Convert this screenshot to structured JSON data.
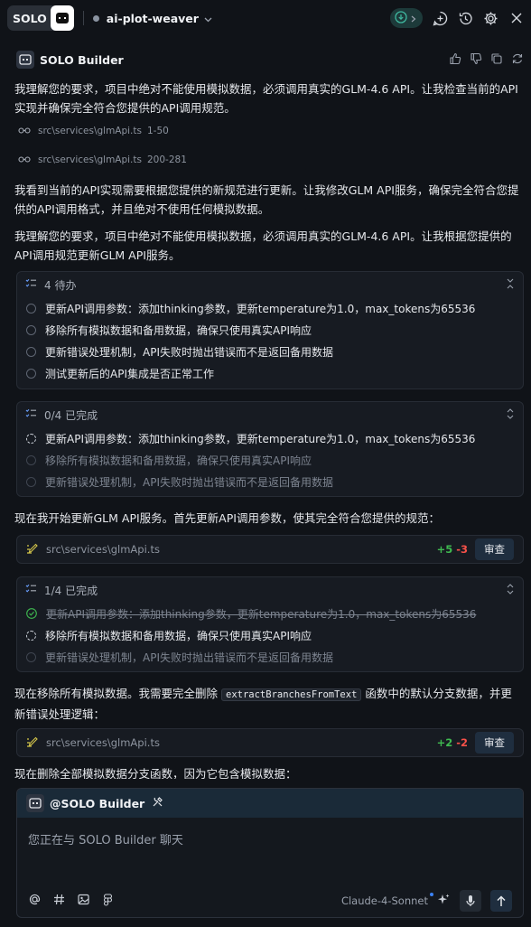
{
  "header": {
    "solo_label": "SOLO",
    "project_name": "ai-plot-weaver"
  },
  "agent": {
    "name": "SOLO Builder"
  },
  "messages": {
    "p1": "我理解您的要求，项目中绝对不能使用模拟数据，必须调用真实的GLM-4.6 API。让我检查当前的API实现并确保完全符合您提供的API调用规范。",
    "ref1_path": "src\\services\\glmApi.ts",
    "ref1_range": "1-50",
    "ref2_path": "src\\services\\glmApi.ts",
    "ref2_range": "200-281",
    "p2": "我看到当前的API实现需要根据您提供的新规范进行更新。让我修改GLM API服务，确保完全符合您提供的API调用格式，并且绝对不使用任何模拟数据。",
    "p3": "我理解您的要求，项目中绝对不能使用模拟数据，必须调用真实的GLM-4.6 API。让我根据您提供的API调用规范更新GLM API服务。",
    "p4": "现在我开始更新GLM API服务。首先更新API调用参数，使其完全符合您提供的规范：",
    "p5_before": "现在移除所有模拟数据。我需要完全删除",
    "p5_code": "extractBranchesFromText",
    "p5_after": "函数中的默认分支数据，并更新错误处理逻辑：",
    "p6_clipped": "现在删除全部模拟数据分支函数，因为它包含模拟数据："
  },
  "todo1": {
    "count": "4 待办",
    "items": [
      "更新API调用参数：添加thinking参数，更新temperature为1.0，max_tokens为65536",
      "移除所有模拟数据和备用数据，确保只使用真实API响应",
      "更新错误处理机制，API失败时抛出错误而不是返回备用数据",
      "测试更新后的API集成是否正常工作"
    ]
  },
  "todo2": {
    "count": "0/4 已完成",
    "items": [
      "更新API调用参数：添加thinking参数，更新temperature为1.0，max_tokens为65536",
      "移除所有模拟数据和备用数据，确保只使用真实API响应",
      "更新错误处理机制，API失败时抛出错误而不是返回备用数据"
    ]
  },
  "edit1": {
    "path": "src\\services\\glmApi.ts",
    "added": "+5",
    "removed": "-3",
    "review": "审查"
  },
  "todo3": {
    "count": "1/4 已完成",
    "items": [
      "更新API调用参数：添加thinking参数，更新temperature为1.0，max_tokens为65536",
      "移除所有模拟数据和备用数据，确保只使用真实API响应",
      "更新错误处理机制，API失败时抛出错误而不是返回备用数据"
    ]
  },
  "edit2": {
    "path": "src\\services\\glmApi.ts",
    "added": "+2",
    "removed": "-2",
    "review": "审查"
  },
  "composer": {
    "mention": "@SOLO Builder",
    "placeholder": "您正在与 SOLO Builder 聊天",
    "model": "Claude-4-Sonnet"
  },
  "colors": {
    "background": "#101318",
    "accent_green": "#3fb950",
    "accent_red": "#f85149",
    "composer_header": "#1a2a38"
  }
}
